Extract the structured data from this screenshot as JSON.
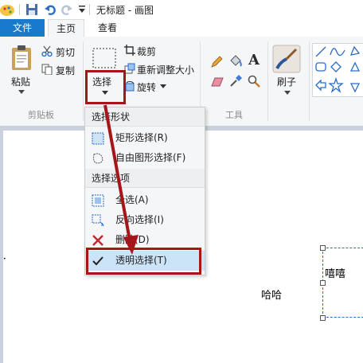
{
  "window": {
    "title": "无标题 - 画图"
  },
  "tabs": [
    {
      "label": "文件"
    },
    {
      "label": "主页"
    },
    {
      "label": "查看"
    }
  ],
  "clipboard": {
    "paste": "粘贴",
    "cut": "剪切",
    "copy": "复制",
    "group": "剪贴板"
  },
  "image": {
    "select": "选择",
    "crop": "裁剪",
    "resize": "重新调整大小",
    "rotate": "旋转"
  },
  "tools": {
    "group": "工具"
  },
  "brushes": {
    "label": "刷子"
  },
  "select_menu": {
    "shapes_header": "选择形状",
    "rect_select": "矩形选择(R)",
    "freeform_select": "自由图形选择(F)",
    "options_header": "选择选项",
    "select_all": "全选(A)",
    "invert_select": "反向选择(I)",
    "delete": "删除(D)",
    "transparent_select": "透明选择(T)"
  },
  "canvas": {
    "text_haha": "哈哈",
    "text_xixi": "嘻嘻"
  },
  "colors": {
    "accent_blue": "#2b579a",
    "file_tab": "#1979ca",
    "annotation_red": "#a5161a"
  }
}
